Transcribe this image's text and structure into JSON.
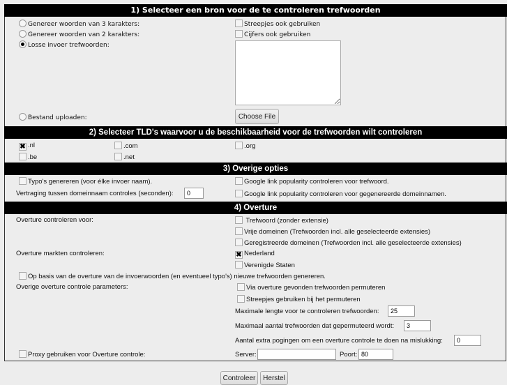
{
  "section1": {
    "title": "1) Selecteer een bron voor de te controleren trefwoorden",
    "radio_gen3": "Genereer woorden van 3 karakters:",
    "radio_gen2": "Genereer woorden van 2 karakters:",
    "radio_manual": "Losse invoer trefwoorden:",
    "radio_upload": "Bestand uploaden:",
    "selected_source": "Losse invoer trefwoorden",
    "check_dashes": "Streepjes ook gebruiken",
    "check_digits": "Cijfers ook gebruiken",
    "keywords_value": "",
    "choose_file": "Choose File"
  },
  "section2": {
    "title": "2) Selecteer TLD's waarvoor u de beschikbaarheid voor de trefwoorden wilt controleren",
    "tlds": [
      {
        "label": ".nl",
        "checked": true
      },
      {
        "label": ".com",
        "checked": false
      },
      {
        "label": ".org",
        "checked": false
      },
      {
        "label": ".be",
        "checked": false
      },
      {
        "label": ".net",
        "checked": false
      }
    ]
  },
  "section3": {
    "title": "3) Overige opties",
    "typos": "Typo's genereren (voor élke invoer naam).",
    "delay_label": "Vertraging tussen domeinnaam controles (seconden):",
    "delay_value": "0",
    "google_keyword": "Google link popularity controleren voor trefwoord.",
    "google_generated": "Google link popularity controleren voor gegenereerde domeinnamen."
  },
  "section4": {
    "title": "4) Overture",
    "check_for_label": "Overture controleren voor:",
    "opt_keyword": " Trefwoord (zonder extensie)",
    "opt_free": "Vrije domeinen (Trefwoorden incl. alle geselecteerde extensies)",
    "opt_registered": "Geregistreerde domeinen (Trefwoorden incl. alle geselecteerde extensies)",
    "markets_label": "Overture markten controleren:",
    "market_nl": "Nederland",
    "market_nl_checked": true,
    "market_us": "Verenigde Staten",
    "generate_new": "Op basis van de overture van de invoerwoorden (en eventueel typo's) nieuwe trefwoorden genereren.",
    "other_params_label": "Overige overture controle parameters:",
    "permute_found": "Via overture gevonden trefwoorden permuteren",
    "permute_dashes": "Streepjes gebruiken bij het permuteren",
    "max_length_label": "Maximale lengte voor te controleren trefwoorden:",
    "max_length_value": "25",
    "max_permuted_label": "Maximaal aantal trefwoorden dat gepermuteerd wordt:",
    "max_permuted_value": "3",
    "retries_label": "Aantal extra pogingen om een overture controle te doen na mislukking:",
    "retries_value": "0",
    "proxy_label": "Proxy gebruiken voor Overture controle:",
    "server_label": "Server:",
    "server_value": "",
    "port_label": "Poort:",
    "port_value": "80"
  },
  "actions": {
    "submit": "Controleer",
    "reset": "Herstel"
  }
}
